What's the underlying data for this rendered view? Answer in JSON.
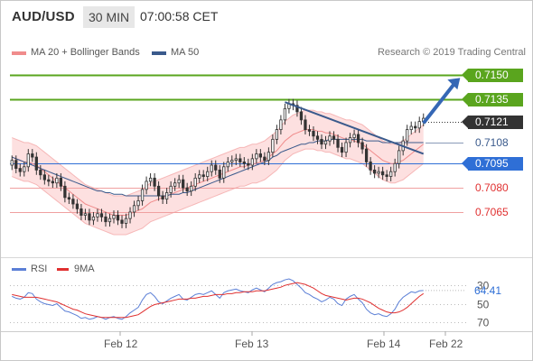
{
  "header": {
    "pair": "AUD/USD",
    "timeframe": "30 MIN",
    "time": "07:00:58 CET"
  },
  "legend": {
    "ma20": "MA 20 + Bollinger Bands",
    "ma50": "MA 50",
    "ma20_color": "#f08c8c",
    "ma50_color": "#3a5a8c",
    "credit": "Research © 2019 Trading Central"
  },
  "rsi_legend": {
    "rsi": "RSI",
    "ma9": "9MA",
    "rsi_color": "#5b7fd6",
    "ma9_color": "#e03030"
  },
  "chart_data": [
    {
      "type": "candlestick",
      "title": "AUD/USD 30 MIN",
      "x_labels": [
        "Feb 12",
        "Feb 13",
        "Feb 14",
        "Feb 22"
      ],
      "ylim": [
        0.7046,
        0.7161
      ],
      "levels": [
        {
          "label": "0.7150",
          "value": 0.715,
          "style": "target",
          "color": "#5aa51e"
        },
        {
          "label": "0.7135",
          "value": 0.7135,
          "style": "target",
          "color": "#5aa51e"
        },
        {
          "label": "0.7121",
          "value": 0.7121,
          "style": "last-price",
          "color": "#333333"
        },
        {
          "label": "0.7108",
          "value": 0.7108,
          "style": "ma50",
          "color": "#3a5a8c"
        },
        {
          "label": "0.7095",
          "value": 0.7095,
          "style": "pivot",
          "color": "#2f6fd6"
        },
        {
          "label": "0.7080",
          "value": 0.708,
          "style": "support",
          "color": "#e05050"
        },
        {
          "label": "0.7065",
          "value": 0.7065,
          "style": "support",
          "color": "#e05050"
        }
      ],
      "close_series": [
        0.7097,
        0.7092,
        0.709,
        0.7093,
        0.7101,
        0.7099,
        0.7091,
        0.7088,
        0.7085,
        0.7084,
        0.7083,
        0.7086,
        0.7081,
        0.7074,
        0.7073,
        0.707,
        0.7067,
        0.7063,
        0.7064,
        0.706,
        0.7062,
        0.7064,
        0.7062,
        0.7059,
        0.7061,
        0.7063,
        0.706,
        0.7058,
        0.7061,
        0.7065,
        0.7069,
        0.7072,
        0.7079,
        0.7084,
        0.7086,
        0.7081,
        0.7075,
        0.7073,
        0.7077,
        0.7081,
        0.7083,
        0.7085,
        0.708,
        0.7078,
        0.7081,
        0.7086,
        0.7088,
        0.7087,
        0.709,
        0.7094,
        0.7091,
        0.7086,
        0.7093,
        0.7096,
        0.7097,
        0.7098,
        0.7096,
        0.7095,
        0.7094,
        0.7098,
        0.7101,
        0.7099,
        0.7097,
        0.7102,
        0.711,
        0.7116,
        0.7122,
        0.7129,
        0.7132,
        0.7131,
        0.7127,
        0.7122,
        0.7116,
        0.7115,
        0.7112,
        0.711,
        0.7107,
        0.7109,
        0.7112,
        0.711,
        0.7105,
        0.7102,
        0.7108,
        0.7111,
        0.7113,
        0.7108,
        0.7104,
        0.7096,
        0.7091,
        0.7089,
        0.709,
        0.7088,
        0.7087,
        0.709,
        0.7095,
        0.7103,
        0.7109,
        0.7116,
        0.7118,
        0.7117,
        0.7121,
        0.7123
      ],
      "ma50_series": [
        0.7099,
        0.7098,
        0.7097,
        0.7096,
        0.7095,
        0.7094,
        0.7093,
        0.7092,
        0.7091,
        0.709,
        0.7089,
        0.7088,
        0.7087,
        0.7086,
        0.7085,
        0.7084,
        0.7083,
        0.7082,
        0.7081,
        0.708,
        0.7079,
        0.7078,
        0.7078,
        0.7077,
        0.7077,
        0.7076,
        0.7076,
        0.7076,
        0.7075,
        0.7075,
        0.7075,
        0.7075,
        0.7075,
        0.7075,
        0.7075,
        0.7075,
        0.7075,
        0.7075,
        0.7075,
        0.7076,
        0.7076,
        0.7076,
        0.7077,
        0.7077,
        0.7078,
        0.7079,
        0.708,
        0.7081,
        0.7082,
        0.7083,
        0.7084,
        0.7085,
        0.7086,
        0.7087,
        0.7088,
        0.7089,
        0.709,
        0.7091,
        0.7092,
        0.7093,
        0.7094,
        0.7095,
        0.7096,
        0.7097,
        0.7099,
        0.71,
        0.7102,
        0.7103,
        0.7104,
        0.7105,
        0.7106,
        0.7107,
        0.7107,
        0.7108,
        0.7108,
        0.7109,
        0.7109,
        0.7109,
        0.711,
        0.711,
        0.711,
        0.711,
        0.711,
        0.711,
        0.711,
        0.711,
        0.711,
        0.7109,
        0.7109,
        0.7109,
        0.7109,
        0.7108,
        0.7108,
        0.7108,
        0.7108,
        0.7108,
        0.7108,
        0.7108,
        0.7108,
        0.7108,
        0.7108,
        0.7108
      ],
      "ma20_series": [
        0.7099,
        0.7098,
        0.7097,
        0.7096,
        0.7096,
        0.7095,
        0.7094,
        0.7092,
        0.709,
        0.7088,
        0.7086,
        0.7084,
        0.7082,
        0.708,
        0.7078,
        0.7076,
        0.7074,
        0.7072,
        0.707,
        0.7069,
        0.7068,
        0.7067,
        0.7066,
        0.7065,
        0.7064,
        0.7063,
        0.7063,
        0.7063,
        0.7063,
        0.7064,
        0.7065,
        0.7066,
        0.7067,
        0.7069,
        0.7071,
        0.7072,
        0.7073,
        0.7074,
        0.7075,
        0.7076,
        0.7077,
        0.7078,
        0.7079,
        0.708,
        0.7081,
        0.7082,
        0.7083,
        0.7084,
        0.7085,
        0.7086,
        0.7087,
        0.7088,
        0.7089,
        0.709,
        0.7091,
        0.7092,
        0.7093,
        0.7093,
        0.7094,
        0.7095,
        0.7095,
        0.7096,
        0.7097,
        0.7099,
        0.7101,
        0.7103,
        0.7106,
        0.7109,
        0.7111,
        0.7113,
        0.7114,
        0.7115,
        0.7116,
        0.7116,
        0.7116,
        0.7115,
        0.7115,
        0.7114,
        0.7114,
        0.7113,
        0.7112,
        0.7111,
        0.711,
        0.711,
        0.7109,
        0.7108,
        0.7107,
        0.7105,
        0.7103,
        0.7101,
        0.7099,
        0.7097,
        0.7096,
        0.7095,
        0.7095,
        0.7096,
        0.7097,
        0.7099,
        0.7101,
        0.7103,
        0.7105,
        0.7107
      ],
      "band_width": 0.0012,
      "trendlines": [
        {
          "from": [
            67,
            0.7133
          ],
          "to": [
            101,
            0.7101
          ],
          "color": "#3a5a8c"
        }
      ],
      "arrow": {
        "from": [
          101,
          0.712
        ],
        "to": [
          110,
          0.7148
        ],
        "color": "#3567b5"
      }
    },
    {
      "type": "line",
      "title": "RSI",
      "ylim": [
        20,
        80
      ],
      "gridlines": [
        30,
        50,
        70
      ],
      "tick_labels": [
        "70",
        "50",
        "30"
      ],
      "last_value_label": "64.41",
      "series": [
        {
          "name": "RSI",
          "values": [
            58,
            56,
            55,
            57,
            62,
            61,
            55,
            52,
            50,
            49,
            48,
            50,
            46,
            42,
            41,
            39,
            37,
            34,
            35,
            33,
            34,
            36,
            35,
            33,
            35,
            36,
            34,
            33,
            36,
            40,
            43,
            46,
            54,
            60,
            62,
            58,
            52,
            50,
            53,
            56,
            58,
            60,
            55,
            54,
            57,
            60,
            61,
            60,
            62,
            64,
            60,
            56,
            62,
            64,
            65,
            66,
            64,
            63,
            62,
            65,
            67,
            65,
            63,
            67,
            71,
            73,
            74,
            76,
            77,
            75,
            71,
            67,
            62,
            60,
            57,
            55,
            52,
            54,
            57,
            55,
            50,
            48,
            55,
            58,
            60,
            55,
            51,
            44,
            40,
            38,
            39,
            37,
            36,
            39,
            44,
            52,
            57,
            60,
            63,
            62,
            64,
            64.41
          ]
        },
        {
          "name": "9MA",
          "values": [
            60,
            59,
            58,
            57,
            57,
            57,
            57,
            56,
            55,
            54,
            53,
            52,
            50,
            48,
            46,
            44,
            43,
            41,
            39,
            38,
            37,
            36,
            35,
            35,
            35,
            35,
            35,
            35,
            35,
            36,
            37,
            38,
            41,
            44,
            47,
            49,
            50,
            51,
            52,
            53,
            54,
            55,
            55,
            55,
            56,
            56,
            57,
            58,
            58,
            59,
            60,
            60,
            60,
            61,
            61,
            62,
            62,
            63,
            63,
            63,
            64,
            64,
            64,
            65,
            66,
            67,
            68,
            70,
            71,
            72,
            73,
            72,
            71,
            69,
            67,
            64,
            61,
            59,
            58,
            57,
            56,
            55,
            54,
            55,
            56,
            56,
            55,
            53,
            51,
            48,
            45,
            43,
            41,
            40,
            40,
            41,
            43,
            46,
            50,
            54,
            58,
            61
          ]
        }
      ]
    }
  ]
}
